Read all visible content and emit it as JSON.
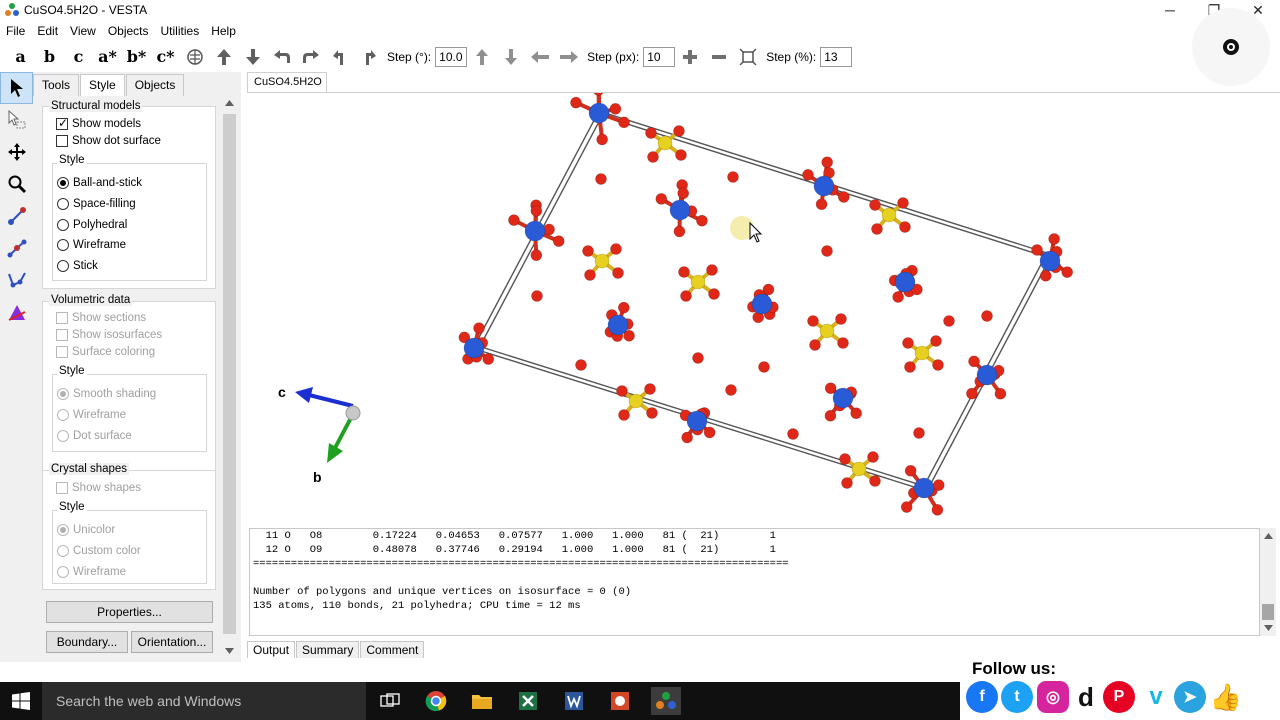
{
  "window": {
    "title": "CuSO4.5H2O - VESTA",
    "minimize": "─",
    "restore": "❐",
    "close": "✕"
  },
  "menu": [
    "File",
    "Edit",
    "View",
    "Objects",
    "Utilities",
    "Help"
  ],
  "toolbar": {
    "axis_letters": [
      "a",
      "b",
      "c",
      "a*",
      "b*",
      "c*"
    ],
    "step_deg_label": "Step (°):",
    "step_deg_value": "10.0",
    "step_px_label": "Step (px):",
    "step_px_value": "10",
    "step_pct_label": "Step (%):",
    "step_pct_value": "13"
  },
  "panel": {
    "tabs": [
      "Tools",
      "Style",
      "Objects"
    ],
    "active_tab": "Style",
    "structural_models": {
      "title": "Structural models",
      "show_models": "Show models",
      "show_dot_surface": "Show dot surface",
      "style_title": "Style",
      "styles": [
        "Ball-and-stick",
        "Space-filling",
        "Polyhedral",
        "Wireframe",
        "Stick"
      ],
      "selected_style": "Ball-and-stick"
    },
    "volumetric": {
      "title": "Volumetric data",
      "show_sections": "Show sections",
      "show_isosurfaces": "Show isosurfaces",
      "surface_coloring": "Surface coloring",
      "style_title": "Style",
      "styles": [
        "Smooth shading",
        "Wireframe",
        "Dot surface"
      ]
    },
    "crystal_shapes": {
      "title": "Crystal shapes",
      "show_shapes": "Show shapes",
      "style_title": "Style",
      "styles": [
        "Unicolor",
        "Custom color",
        "Wireframe"
      ]
    },
    "properties_button": "Properties...",
    "boundary_button": "Boundary...",
    "orientation_button": "Orientation..."
  },
  "view": {
    "tab_label": "CuSO4.5H2O",
    "axis_c": "c",
    "axis_b": "b"
  },
  "output": {
    "lines": [
      "  11 O   O8        0.17224   0.04653   0.07577   1.000   1.000   81 (  21)        1",
      "  12 O   O9        0.48078   0.37746   0.29194   1.000   1.000   81 (  21)        1",
      "=====================================================================================",
      "",
      "Number of polygons and unique vertices on isosurface = 0 (0)",
      "135 atoms, 110 bonds, 21 polyhedra; CPU time = 12 ms"
    ],
    "tabs": [
      "Output",
      "Summary",
      "Comment"
    ]
  },
  "taskbar": {
    "search_placeholder": "Search the web and Windows"
  },
  "follow": {
    "label": "Follow us:"
  },
  "colors": {
    "cu": "#2a5bd7",
    "s": "#e8d020",
    "o": "#e02818",
    "bond_red": "#d03020"
  }
}
